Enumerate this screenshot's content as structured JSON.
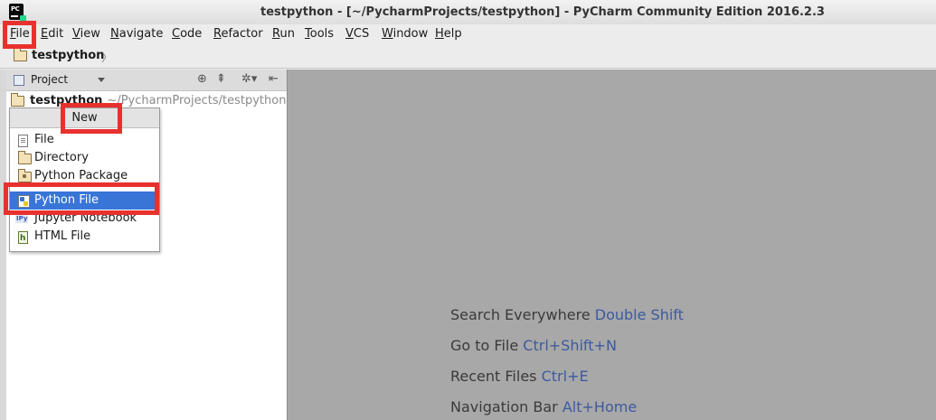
{
  "window": {
    "title": "testpython - [~/PycharmProjects/testpython] - PyCharm Community Edition 2016.2.3",
    "logo_text": "PC"
  },
  "menu": [
    "File",
    "Edit",
    "View",
    "Navigate",
    "Code",
    "Refactor",
    "Run",
    "Tools",
    "VCS",
    "Window",
    "Help"
  ],
  "breadcrumb": {
    "project": "testpython"
  },
  "project_panel": {
    "view_label": "Project",
    "root_name": "testpython",
    "root_path": "~/PycharmProjects/testpython"
  },
  "new_menu": {
    "header": "New",
    "items": [
      {
        "label": "File",
        "icon": "file-icon"
      },
      {
        "label": "Directory",
        "icon": "folder-icon"
      },
      {
        "label": "Python Package",
        "icon": "package-icon"
      },
      {
        "label": "Python File",
        "icon": "python-file-icon",
        "selected": true
      },
      {
        "label": "Jupyter Notebook",
        "icon": "jupyter-icon"
      },
      {
        "label": "HTML File",
        "icon": "html-file-icon"
      }
    ]
  },
  "editor_hints": [
    {
      "text": "Search Everywhere",
      "shortcut": "Double Shift"
    },
    {
      "text": "Go to File",
      "shortcut": "Ctrl+Shift+N"
    },
    {
      "text": "Recent Files",
      "shortcut": "Ctrl+E"
    },
    {
      "text": "Navigation Bar",
      "shortcut": "Alt+Home"
    }
  ],
  "colors": {
    "selection": "#3875d7",
    "highlight": "#e8312f",
    "shortcut": "#3d5a9e"
  }
}
